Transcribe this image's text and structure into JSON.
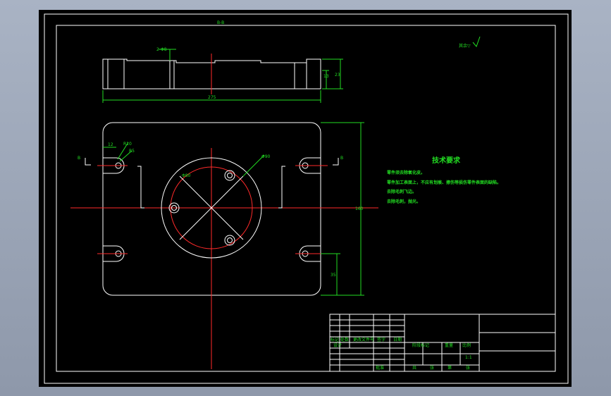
{
  "section_label": "B-B",
  "roughness_note": "其余▽",
  "dims": {
    "depth_label": "2-Φ8",
    "width_top": "275",
    "height_a": "13",
    "height_b": "23",
    "hole_12": "12",
    "r_label": "R10",
    "r_label2": "R5",
    "dia_left": "Φ80",
    "dia_right": "Φ90",
    "height_total": "160",
    "offset_35": "35",
    "side_b": "B"
  },
  "requirements": {
    "title": "技术要求",
    "items": [
      "零件须去除氧化皮。",
      "零件加工表面上，不应有划痕、擦伤等损伤零件表面的缺陷。",
      "去除毛刺飞边。",
      "去除毛刺，抛光。"
    ]
  },
  "title_block": {
    "row_labels": [
      "标记",
      "处数",
      "更改文件号",
      "签字",
      "日期"
    ],
    "designer_label": "设计",
    "stage_labels": [
      "阶段标记",
      "重量",
      "比例"
    ],
    "scale_value": "1:1",
    "sheet_labels": [
      "共",
      "张",
      "第",
      "张"
    ],
    "approve_label": "批准"
  },
  "colors": {
    "background": "#000000",
    "outline": "#ffffff",
    "centerline": "#ff2a2a",
    "dimension": "#22dd22"
  }
}
